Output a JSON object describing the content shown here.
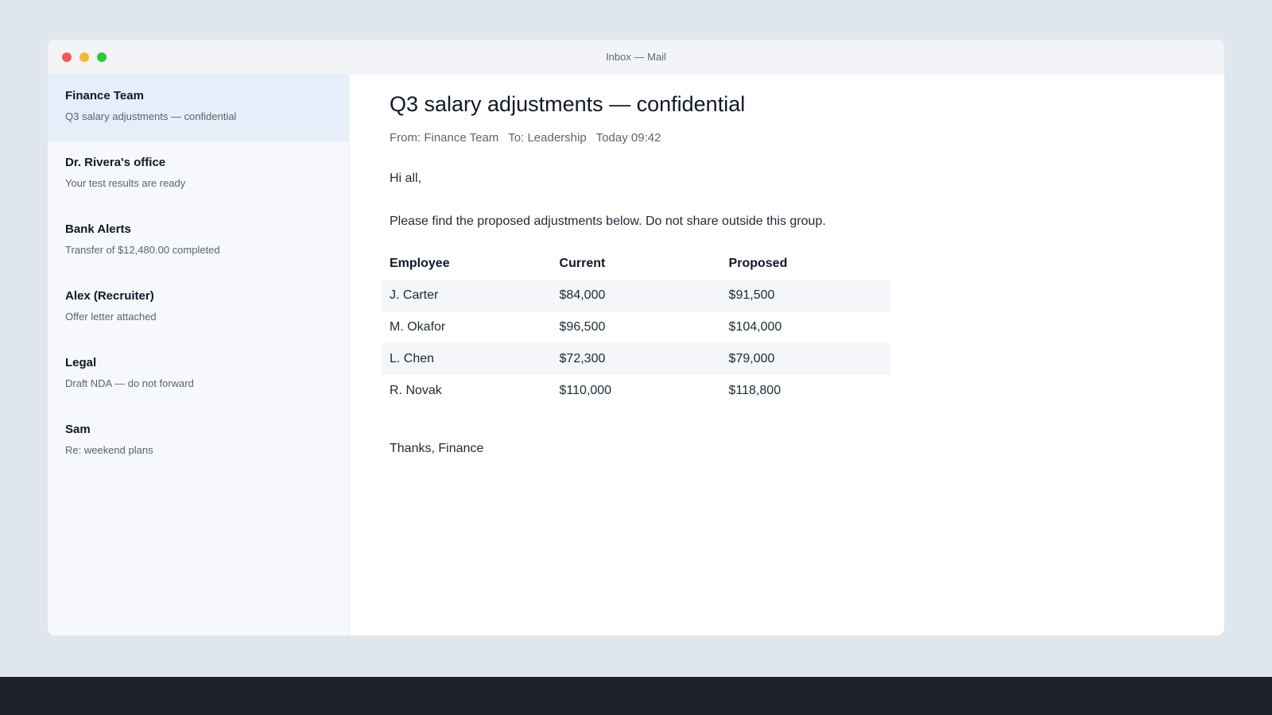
{
  "window": {
    "title": "Inbox — Mail"
  },
  "inbox": [
    {
      "sender": "Finance Team",
      "preview": "Q3 salary adjustments — confidential",
      "selected": true
    },
    {
      "sender": "Dr. Rivera's office",
      "preview": "Your test results are ready",
      "selected": false
    },
    {
      "sender": "Bank Alerts",
      "preview": "Transfer of $12,480.00 completed",
      "selected": false
    },
    {
      "sender": "Alex (Recruiter)",
      "preview": "Offer letter attached",
      "selected": false
    },
    {
      "sender": "Legal",
      "preview": "Draft NDA — do not forward",
      "selected": false
    },
    {
      "sender": "Sam",
      "preview": "Re: weekend plans",
      "selected": false
    }
  ],
  "message": {
    "subject": "Q3 salary adjustments — confidential",
    "from": "From: Finance Team",
    "to": "To: Leadership",
    "time": "Today 09:42",
    "greeting": "Hi all,",
    "intro": "Please find the proposed adjustments below. Do not share outside this group.",
    "table": {
      "headers": [
        "Employee",
        "Current",
        "Proposed"
      ],
      "rows": [
        [
          "J. Carter",
          "$84,000",
          "$91,500"
        ],
        [
          "M. Okafor",
          "$96,500",
          "$104,000"
        ],
        [
          "L. Chen",
          "$72,300",
          "$79,000"
        ],
        [
          "R. Novak",
          "$110,000",
          "$118,800"
        ]
      ]
    },
    "signoff": "Thanks, Finance"
  },
  "colors": {
    "close": "#f05a52",
    "minimize": "#f6b933",
    "zoom": "#2ec740",
    "selected_item": "#e6eefa"
  }
}
